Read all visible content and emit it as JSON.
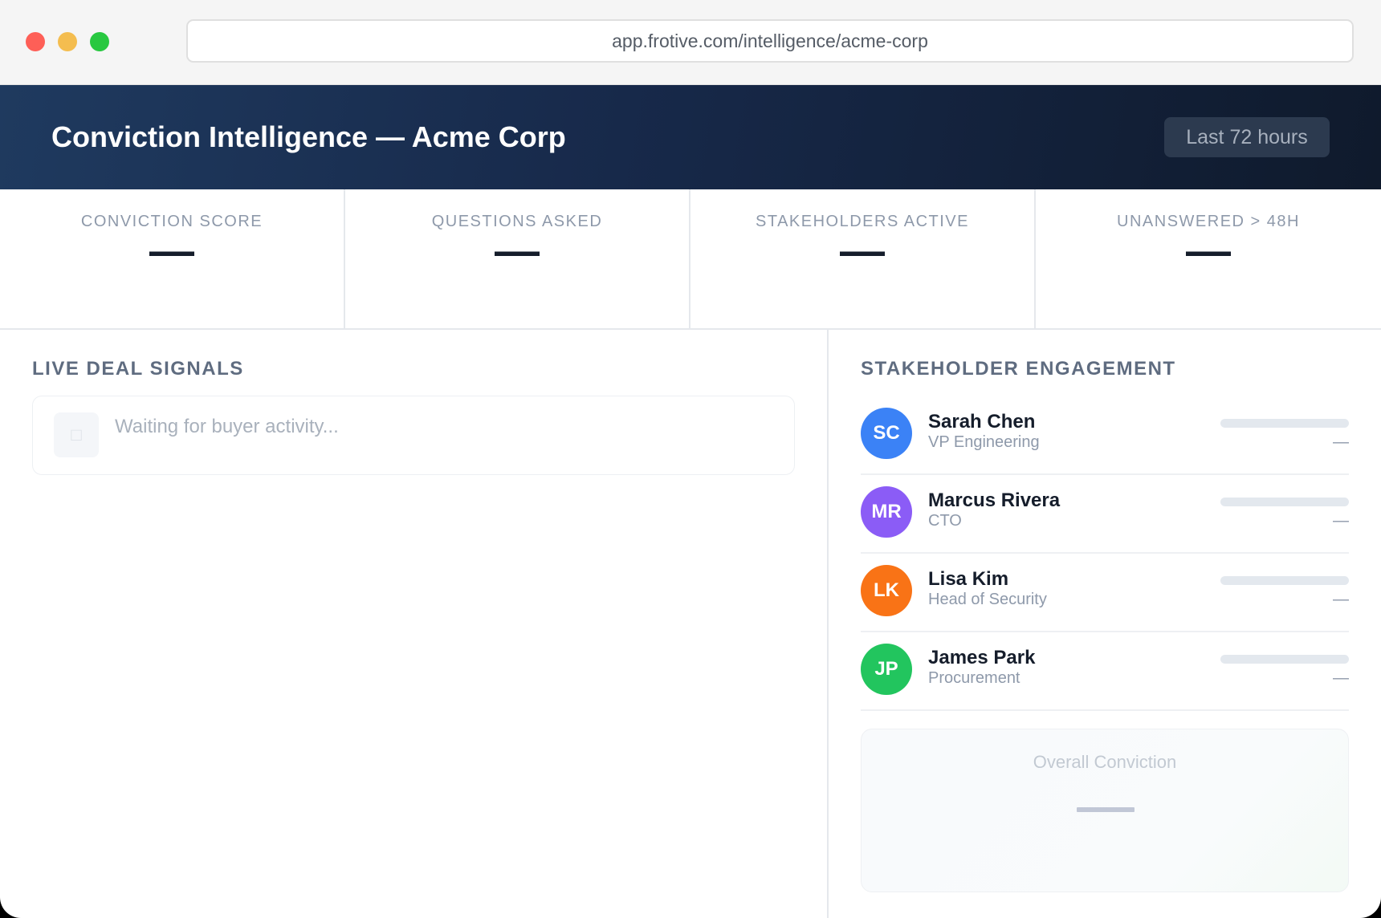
{
  "browser": {
    "url": "app.frotive.com/intelligence/acme-corp"
  },
  "header": {
    "title": "Conviction Intelligence — Acme Corp",
    "time_range": "Last 72 hours"
  },
  "stats": [
    {
      "label": "CONVICTION SCORE",
      "value": "—"
    },
    {
      "label": "QUESTIONS ASKED",
      "value": "—"
    },
    {
      "label": "STAKEHOLDERS ACTIVE",
      "value": "—"
    },
    {
      "label": "UNANSWERED > 48H",
      "value": "—"
    }
  ],
  "signals": {
    "title": "LIVE DEAL SIGNALS",
    "empty_text": "Waiting for buyer activity...",
    "icon": "signal-placeholder-icon"
  },
  "engagement": {
    "title": "STAKEHOLDER ENGAGEMENT",
    "stakeholders": [
      {
        "initials": "SC",
        "name": "Sarah Chen",
        "role": "VP Engineering",
        "value": "—",
        "color": "#3b82f6",
        "level": 0
      },
      {
        "initials": "MR",
        "name": "Marcus Rivera",
        "role": "CTO",
        "value": "—",
        "color": "#8b5cf6",
        "level": 0
      },
      {
        "initials": "LK",
        "name": "Lisa Kim",
        "role": "Head of Security",
        "value": "—",
        "color": "#f97316",
        "level": 0
      },
      {
        "initials": "JP",
        "name": "James Park",
        "role": "Procurement",
        "value": "—",
        "color": "#22c55e",
        "level": 0
      }
    ],
    "overall": {
      "label": "Overall Conviction",
      "value": "—"
    }
  },
  "colors": {
    "header_start": "#1f3a5f",
    "header_end": "#0f1a2c",
    "traffic_red": "#fe5f57",
    "traffic_yellow": "#f4bd4f",
    "traffic_green": "#28c840"
  }
}
